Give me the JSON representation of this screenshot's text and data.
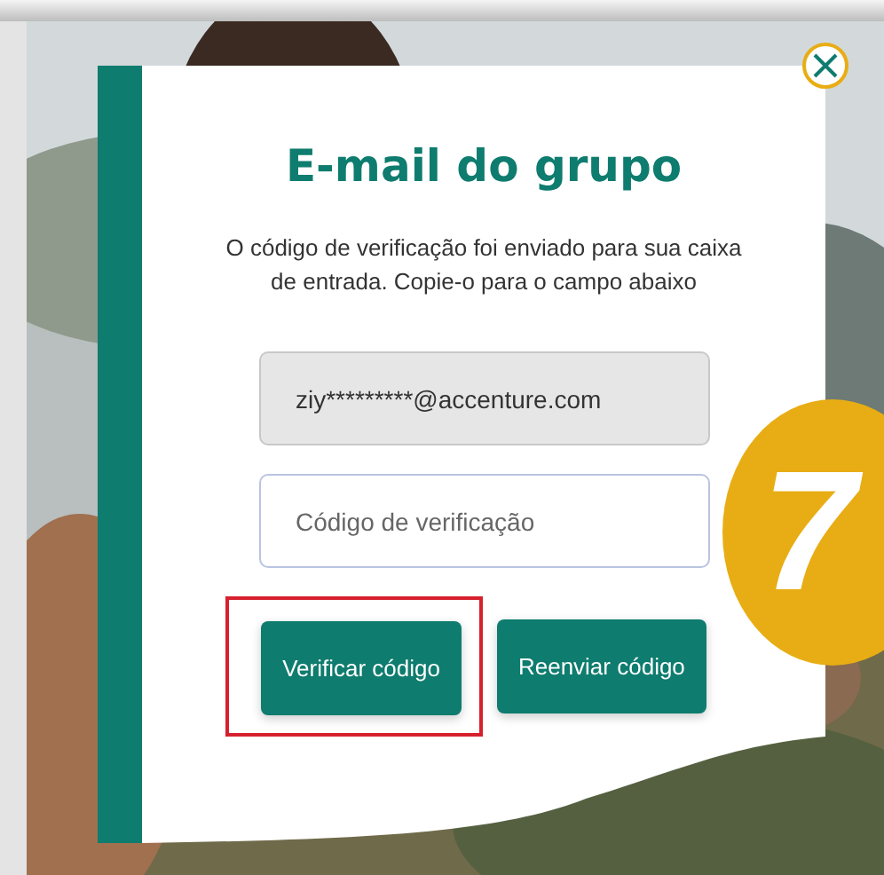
{
  "title": "E-mail do grupo",
  "message": "O código de verificação foi enviado para sua caixa de entrada. Copie-o para o campo abaixo",
  "email_field": {
    "value": "ziy*********@accenture.com",
    "disabled": true
  },
  "code_field": {
    "placeholder": "Código de verificação"
  },
  "buttons": [
    {
      "label": "Verificar código",
      "highlighted": true
    },
    {
      "label": "Reenviar código",
      "highlighted": false
    }
  ],
  "step_badge": "7"
}
